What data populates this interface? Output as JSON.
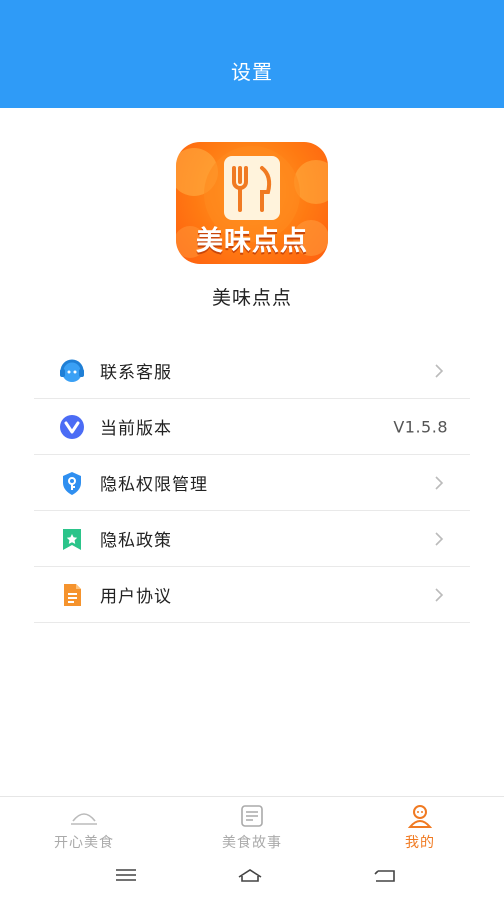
{
  "header": {
    "title": "设置"
  },
  "app": {
    "logo_text": "美味点点",
    "name": "美味点点"
  },
  "menu": [
    {
      "label": "联系客服",
      "icon": "headset-icon"
    },
    {
      "label": "当前版本",
      "icon": "version-icon",
      "value": "V1.5.8"
    },
    {
      "label": "隐私权限管理",
      "icon": "shield-key-icon"
    },
    {
      "label": "隐私政策",
      "icon": "bookmark-star-icon"
    },
    {
      "label": "用户协议",
      "icon": "document-icon"
    }
  ],
  "tabs": [
    {
      "label": "开心美食",
      "icon": "home-icon",
      "active": false
    },
    {
      "label": "美食故事",
      "icon": "list-icon",
      "active": false
    },
    {
      "label": "我的",
      "icon": "profile-icon",
      "active": true
    }
  ],
  "colors": {
    "header": "#2f9bf7",
    "accent": "#f07a22",
    "logo": "#ff7a12"
  }
}
